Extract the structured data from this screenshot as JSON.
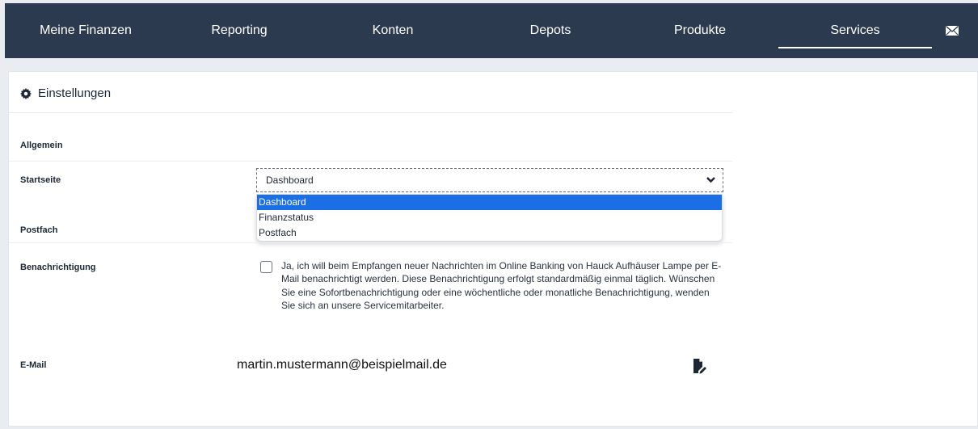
{
  "nav": {
    "items": [
      {
        "label": "Meine Finanzen"
      },
      {
        "label": "Reporting"
      },
      {
        "label": "Konten"
      },
      {
        "label": "Depots"
      },
      {
        "label": "Produkte"
      },
      {
        "label": "Services",
        "active": true
      }
    ],
    "mail_icon": "envelope-icon"
  },
  "page": {
    "title": "Einstellungen",
    "title_icon": "gear-icon"
  },
  "settings": {
    "section_general": "Allgemein",
    "startseite": {
      "label": "Startseite",
      "selected": "Dashboard",
      "options": [
        "Dashboard",
        "Finanzstatus",
        "Postfach"
      ]
    },
    "postfach": {
      "label": "Postfach"
    },
    "benachrichtigung": {
      "label": "Benachrichtigung",
      "checked": false,
      "text": "Ja, ich will beim Empfangen neuer Nachrichten im Online Banking von Hauck Aufhäuser Lampe per E-Mail benachrichtigt werden. Diese Benachrichtigung erfolgt standardmäßig einmal täglich. Wünschen Sie eine Sofortbenachrichtigung oder eine wöchentliche oder monatliche Benachrichtigung, wenden Sie sich an unsere Servicemitarbeiter."
    },
    "email": {
      "label": "E-Mail",
      "value": "martin.mustermann@beispielmail.de",
      "edit_icon": "edit-icon"
    }
  },
  "colors": {
    "nav_bg": "#2c3a4f",
    "selected_option": "#1b6ee3"
  }
}
